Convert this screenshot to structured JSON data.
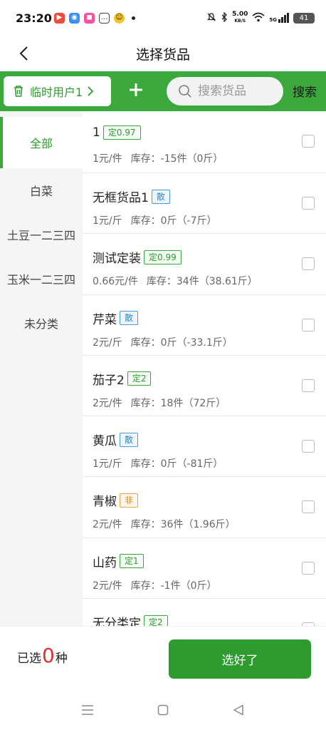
{
  "status_bar": {
    "time": "23:20",
    "net_speed_value": "5.00",
    "net_speed_unit": "KB/S",
    "network": "5G",
    "battery": "41",
    "app_icons": [
      {
        "name": "video-app-icon",
        "color": "#f04a3a"
      },
      {
        "name": "chat-app-icon",
        "color": "#3b8ff5"
      },
      {
        "name": "shop-app-icon",
        "color": "#ff4fa1"
      },
      {
        "name": "message-app-icon",
        "color": "#444444"
      },
      {
        "name": "emoji-app-icon",
        "color": "#f7c52a"
      }
    ]
  },
  "nav": {
    "title": "选择货品"
  },
  "toolbar": {
    "customer_label": "临时用户1",
    "search_placeholder": "搜索货品",
    "search_button": "搜索"
  },
  "categories": [
    {
      "label": "全部",
      "active": true
    },
    {
      "label": "白菜",
      "active": false
    },
    {
      "label": "土豆一二三四",
      "active": false
    },
    {
      "label": "玉米一二三四",
      "active": false
    },
    {
      "label": "未分类",
      "active": false
    }
  ],
  "items": [
    {
      "name": "1",
      "tag": "定0.97",
      "tag_type": "ding",
      "price": "1元/件",
      "stock": "库存：-15件（0斤）"
    },
    {
      "name": "无框货品1",
      "tag": "散",
      "tag_type": "san",
      "price": "1元/斤",
      "stock": "库存：0斤（-7斤）"
    },
    {
      "name": "测试定装",
      "tag": "定0.99",
      "tag_type": "ding",
      "price": "0.66元/件",
      "stock": "库存：34件（38.61斤）"
    },
    {
      "name": "芹菜",
      "tag": "散",
      "tag_type": "san",
      "price": "2元/斤",
      "stock": "库存：0斤（-33.1斤）"
    },
    {
      "name": "茄子2",
      "tag": "定2",
      "tag_type": "ding",
      "price": "2元/件",
      "stock": "库存：18件（72斤）"
    },
    {
      "name": "黄瓜",
      "tag": "散",
      "tag_type": "san",
      "price": "1元/斤",
      "stock": "库存：0斤（-81斤）"
    },
    {
      "name": "青椒",
      "tag": "非",
      "tag_type": "fei",
      "price": "2元/件",
      "stock": "库存：36件（1.96斤）"
    },
    {
      "name": "山药",
      "tag": "定1",
      "tag_type": "ding",
      "price": "2元/件",
      "stock": "库存：-1件（0斤）"
    },
    {
      "name": "无分类定",
      "tag": "定2",
      "tag_type": "ding",
      "price": "",
      "stock": ""
    }
  ],
  "bottom": {
    "selected_prefix": "已选",
    "selected_count": "0",
    "selected_suffix": "种",
    "done_label": "选好了"
  },
  "colors": {
    "brand_green": "#3aa83b",
    "count_red": "#e03131"
  }
}
